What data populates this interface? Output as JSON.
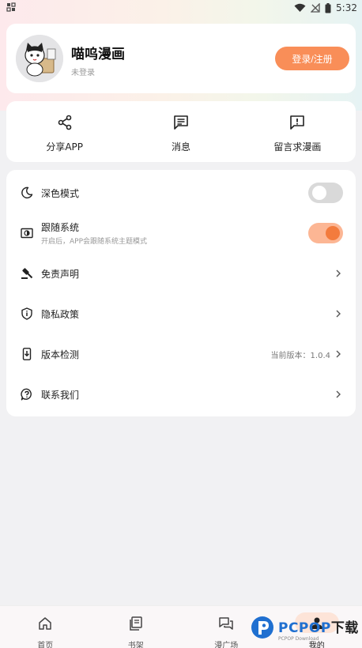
{
  "status_bar": {
    "time": "5:32",
    "icons": [
      "notification-icon",
      "wifi-icon",
      "no-signal-icon",
      "battery-icon"
    ]
  },
  "profile": {
    "app_name": "喵呜漫画",
    "login_state": "未登录",
    "login_button": "登录/注册"
  },
  "actions": [
    {
      "label": "分享APP",
      "icon": "share-icon"
    },
    {
      "label": "消息",
      "icon": "message-icon"
    },
    {
      "label": "留言求漫画",
      "icon": "feedback-icon"
    }
  ],
  "settings": {
    "dark_mode": {
      "label": "深色模式",
      "icon": "moon-icon",
      "enabled": false
    },
    "follow_system": {
      "label": "跟随系统",
      "sub": "开启后，APP会跟随系统主题模式",
      "icon": "theme-icon",
      "enabled": true
    },
    "disclaimer": {
      "label": "免责声明",
      "icon": "gavel-icon"
    },
    "privacy": {
      "label": "隐私政策",
      "icon": "shield-icon"
    },
    "version": {
      "label": "版本检测",
      "value": "当前版本：1.0.4",
      "icon": "phone-update-icon"
    },
    "contact": {
      "label": "联系我们",
      "icon": "help-icon"
    }
  },
  "nav": [
    {
      "label": "首页",
      "icon": "home-icon",
      "active": false
    },
    {
      "label": "书架",
      "icon": "bookshelf-icon",
      "active": false
    },
    {
      "label": "漫广场",
      "icon": "forum-icon",
      "active": false
    },
    {
      "label": "我的",
      "icon": "person-icon",
      "active": true
    }
  ],
  "watermark": {
    "text": "PCPOP",
    "suffix": "下载",
    "sub": "PCPOP Download"
  },
  "colors": {
    "accent": "#f98e58",
    "toggle_on": "#f37b3d",
    "toggle_on_track": "#fcb694"
  }
}
